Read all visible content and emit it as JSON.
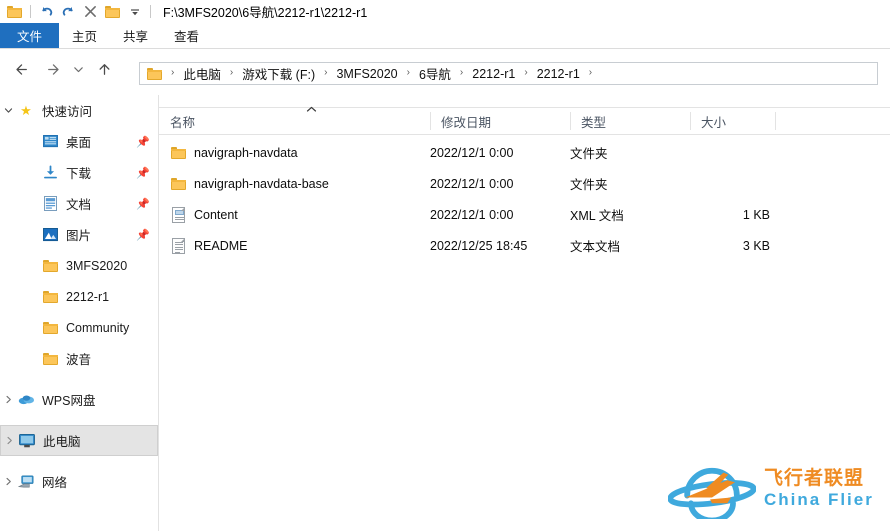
{
  "window": {
    "title_path": "F:\\3MFS2020\\6导航\\2212-r1\\2212-r1",
    "quick_access_toolbar": [
      {
        "name": "folder-icon",
        "label": "属性"
      },
      {
        "name": "undo-icon",
        "label": "撤消"
      },
      {
        "name": "redo-icon",
        "label": "恢复"
      },
      {
        "name": "delete-icon",
        "label": "删除"
      },
      {
        "name": "new-folder-icon",
        "label": "新建文件夹"
      },
      {
        "name": "chevron-down-icon",
        "label": "自定义快速访问工具栏"
      }
    ]
  },
  "ribbon": {
    "tabs": [
      {
        "label": "文件",
        "active": true
      },
      {
        "label": "主页",
        "active": false
      },
      {
        "label": "共享",
        "active": false
      },
      {
        "label": "查看",
        "active": false
      }
    ]
  },
  "navigation": {
    "back_label": "后退",
    "forward_label": "前进",
    "recent_label": "最近浏览的位置",
    "up_label": "上移一级",
    "breadcrumbs": [
      "此电脑",
      "游戏下载 (F:)",
      "3MFS2020",
      "6导航",
      "2212-r1",
      "2212-r1"
    ],
    "separator": "›"
  },
  "sidebar": {
    "items": [
      {
        "label": "快速访问",
        "icon": "star-icon",
        "indent": 0,
        "chevron": "open",
        "pinned": false,
        "selected": false
      },
      {
        "label": "桌面",
        "icon": "desktop-icon",
        "indent": 2,
        "chevron": "none",
        "pinned": true,
        "selected": false
      },
      {
        "label": "下载",
        "icon": "downloads-icon",
        "indent": 2,
        "chevron": "none",
        "pinned": true,
        "selected": false
      },
      {
        "label": "文档",
        "icon": "documents-icon",
        "indent": 2,
        "chevron": "none",
        "pinned": true,
        "selected": false
      },
      {
        "label": "图片",
        "icon": "pictures-icon",
        "indent": 2,
        "chevron": "none",
        "pinned": true,
        "selected": false
      },
      {
        "label": "3MFS2020",
        "icon": "folder-icon",
        "indent": 2,
        "chevron": "none",
        "pinned": false,
        "selected": false
      },
      {
        "label": "2212-r1",
        "icon": "folder-icon",
        "indent": 2,
        "chevron": "none",
        "pinned": false,
        "selected": false
      },
      {
        "label": "Community",
        "icon": "folder-icon",
        "indent": 2,
        "chevron": "none",
        "pinned": false,
        "selected": false
      },
      {
        "label": "波音",
        "icon": "folder-icon",
        "indent": 2,
        "chevron": "none",
        "pinned": false,
        "selected": false
      },
      {
        "label": "WPS网盘",
        "icon": "cloud-icon",
        "indent": 0,
        "chevron": "closed",
        "pinned": false,
        "selected": false
      },
      {
        "label": "此电脑",
        "icon": "computer-icon",
        "indent": 0,
        "chevron": "closed",
        "pinned": false,
        "selected": true
      },
      {
        "label": "网络",
        "icon": "network-icon",
        "indent": 0,
        "chevron": "closed",
        "pinned": false,
        "selected": false
      }
    ]
  },
  "file_list": {
    "columns": [
      {
        "label": "名称",
        "sorted": "asc"
      },
      {
        "label": "修改日期",
        "sorted": "none"
      },
      {
        "label": "类型",
        "sorted": "none"
      },
      {
        "label": "大小",
        "sorted": "none"
      }
    ],
    "sort_caret": "︿",
    "rows": [
      {
        "name": "navigraph-navdata",
        "date": "2022/12/1 0:00",
        "type": "文件夹",
        "size": "",
        "icon": "folder-icon"
      },
      {
        "name": "navigraph-navdata-base",
        "date": "2022/12/1 0:00",
        "type": "文件夹",
        "size": "",
        "icon": "folder-icon"
      },
      {
        "name": "Content",
        "date": "2022/12/1 0:00",
        "type": "XML 文档",
        "size": "1 KB",
        "icon": "xml-file-icon"
      },
      {
        "name": "README",
        "date": "2022/12/25 18:45",
        "type": "文本文档",
        "size": "3 KB",
        "icon": "text-file-icon"
      }
    ]
  },
  "watermark": {
    "chinese": "飞行者联盟",
    "english": "China Flier",
    "logo_name": "china-flier-logo",
    "orange": "#ef8b22",
    "blue": "#3fa9dd"
  }
}
